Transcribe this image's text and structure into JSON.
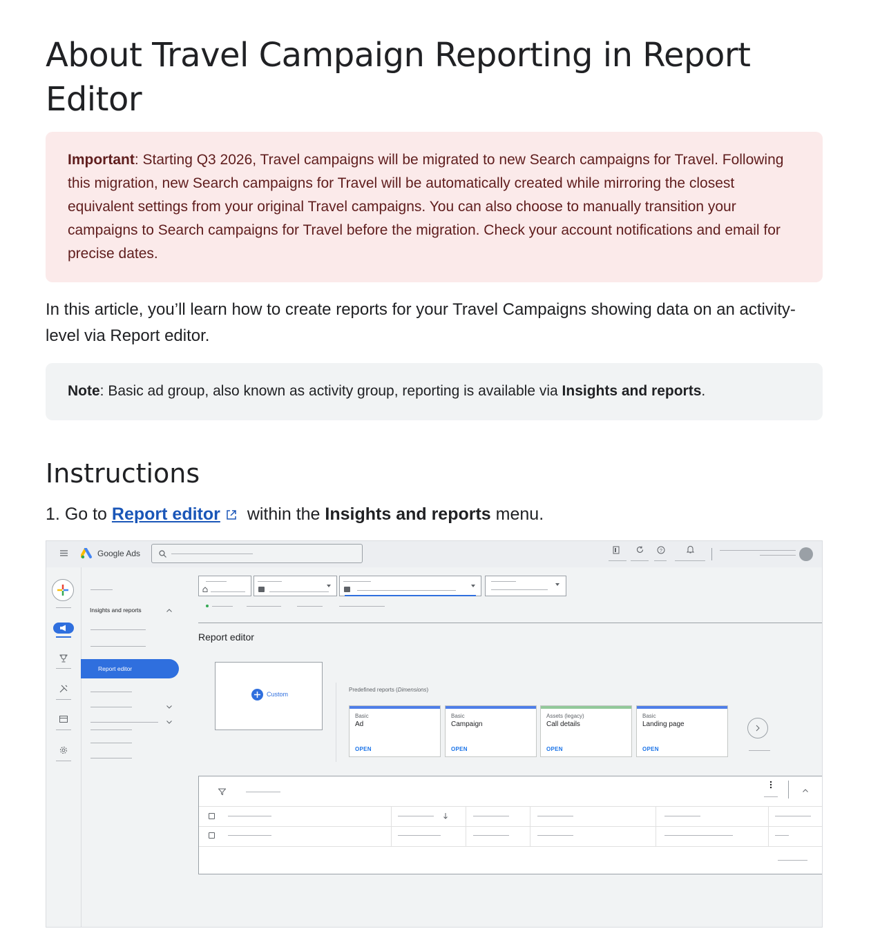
{
  "article": {
    "title": "About Travel Campaign Reporting in Report Editor",
    "important": {
      "label": "Important",
      "text": ": Starting Q3 2026, Travel campaigns will be migrated to new Search campaigns for Travel. Following this migration, new Search campaigns for Travel will be automatically created while mirroring the closest equivalent settings from your original Travel campaigns. You can also choose to manually transition your campaigns to Search campaigns for Travel before the migration. Check your account notifications and email for precise dates."
    },
    "intro": "In this article, you’ll learn how to create reports for your Travel Campaigns showing data on an activity-level via Report editor.",
    "note": {
      "label": "Note",
      "text": ": Basic ad group, also known as activity group, reporting is available via ",
      "link_label": "Insights and reports",
      "end": "."
    },
    "instructions_heading": "Instructions",
    "step1": {
      "number": "1.",
      "prefix": "Go to",
      "link": "Report editor",
      "middle": "within the",
      "bold": "Insights and reports",
      "suffix": "menu."
    }
  },
  "screenshot": {
    "brand": "Google Ads",
    "nav_section": "Insights and reports",
    "nav_active": "Report editor",
    "page_title": "Report editor",
    "predefined_prefix": "Predefined reports (",
    "predefined_italic": "Dimensions",
    "predefined_suffix": ")",
    "custom_label": "Custom",
    "cards": [
      {
        "kind": "Basic",
        "name": "Ad",
        "action": "OPEN",
        "accent": "#4f7ee8"
      },
      {
        "kind": "Basic",
        "name": "Campaign",
        "action": "OPEN",
        "accent": "#4f7ee8"
      },
      {
        "kind": "Assets (legacy)",
        "name": "Call details",
        "action": "OPEN",
        "accent": "#93c99a"
      },
      {
        "kind": "Basic",
        "name": "Landing page",
        "action": "OPEN",
        "accent": "#4f7ee8"
      }
    ],
    "colors": {
      "accent": "#2f6fde",
      "link": "#1a56b8",
      "important_bg": "#fbeaea",
      "important_text": "#5f1d1d"
    }
  }
}
